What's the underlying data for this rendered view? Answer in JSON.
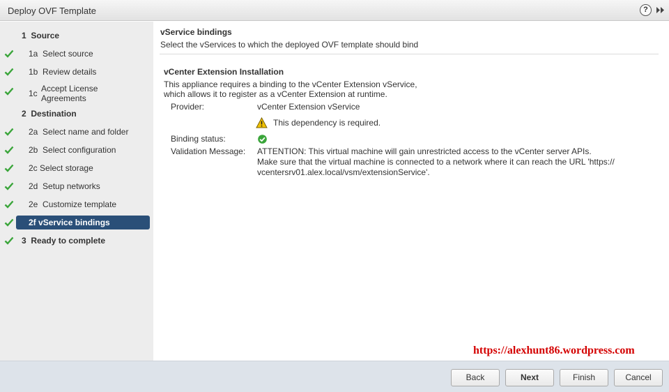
{
  "window": {
    "title": "Deploy OVF Template",
    "help_glyph": "?"
  },
  "sidebar": {
    "steps": [
      {
        "num": "1",
        "label": "Source",
        "type": "group",
        "checked": false
      },
      {
        "num": "1a",
        "label": "Select source",
        "type": "sub",
        "checked": true
      },
      {
        "num": "1b",
        "label": "Review details",
        "type": "sub",
        "checked": true
      },
      {
        "num": "1c",
        "label": "Accept License Agreements",
        "type": "sub",
        "checked": true
      },
      {
        "num": "2",
        "label": "Destination",
        "type": "group",
        "checked": false
      },
      {
        "num": "2a",
        "label": "Select name and folder",
        "type": "sub",
        "checked": true
      },
      {
        "num": "2b",
        "label": "Select configuration",
        "type": "sub",
        "checked": true
      },
      {
        "num": "2c",
        "label": "Select storage",
        "type": "sub",
        "checked": true
      },
      {
        "num": "2d",
        "label": "Setup networks",
        "type": "sub",
        "checked": true
      },
      {
        "num": "2e",
        "label": "Customize template",
        "type": "sub",
        "checked": true
      },
      {
        "num": "2f",
        "label": "vService bindings",
        "type": "sub",
        "checked": true,
        "active": true
      },
      {
        "num": "3",
        "label": "Ready to complete",
        "type": "group",
        "checked": true
      }
    ]
  },
  "main": {
    "title": "vService bindings",
    "subtitle": "Select the vServices to which the deployed OVF template should bind",
    "section_title": "vCenter Extension Installation",
    "description_line1": "This appliance requires a binding to the vCenter Extension vService,",
    "description_line2": "which allows it to register as a vCenter Extension at runtime.",
    "provider_label": "Provider:",
    "provider_value": "vCenter Extension vService",
    "dependency_warning": "This dependency is required.",
    "binding_status_label": "Binding status:",
    "validation_label": "Validation Message:",
    "validation_line1": "ATTENTION: This virtual machine will gain unrestricted access to the vCenter server APIs.",
    "validation_line2": "Make sure that the virtual machine is connected to a network where it can reach the URL 'https://",
    "validation_line3": "vcentersrv01.alex.local/vsm/extensionService'."
  },
  "watermark": "https://alexhunt86.wordpress.com",
  "footer": {
    "back_label": "Back",
    "next_label": "Next",
    "finish_label": "Finish",
    "cancel_label": "Cancel"
  },
  "colors": {
    "active_step": "#2a4f78",
    "check_green": "#3aa53a",
    "watermark_red": "#d40000",
    "warning_yellow": "#f2c200"
  }
}
